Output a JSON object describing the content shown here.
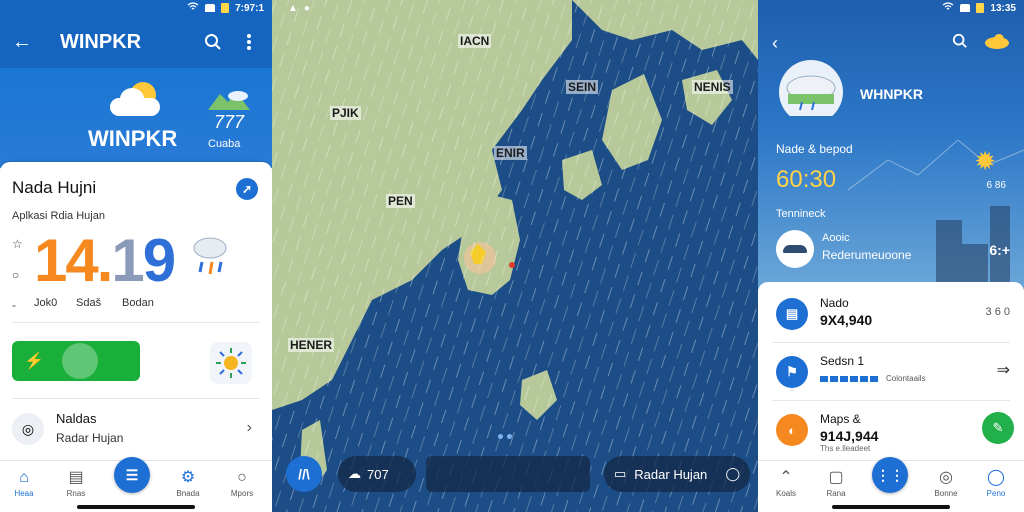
{
  "screen1": {
    "status": {
      "time": "7:97:1"
    },
    "appbar": {
      "title": "WINPKR",
      "back_icon": "arrow-left",
      "search_icon": "search",
      "more_icon": "more-vertical"
    },
    "hero": {
      "name": "WINPKR",
      "temp": "777",
      "sub": "Cuaba"
    },
    "card": {
      "heading": "Nada Hujni",
      "label": "Aplkasi Rdia Hujan",
      "big_number_part1": "14.",
      "big_number_part2": "1",
      "big_number_part3": "9",
      "mini_labels": [
        "Jok0",
        "Sdaš",
        "Bodan"
      ],
      "row": {
        "title": "Naldas",
        "subtitle": "Radar Hujan"
      }
    },
    "nav": [
      {
        "label": "Heaa",
        "icon": "home"
      },
      {
        "label": "Rnas",
        "icon": "list"
      },
      {
        "label": "",
        "icon": "menu"
      },
      {
        "label": "Bnada",
        "icon": "gear"
      },
      {
        "label": "Mpors",
        "icon": "circle"
      }
    ]
  },
  "screen2": {
    "map_labels": [
      "IACN",
      "SEIN",
      "NENIS",
      "PJIK",
      "ENIR",
      "PEN",
      "HENER"
    ],
    "bottom": {
      "temp": "707",
      "pill_label": "Radar Hujan"
    }
  },
  "screen3": {
    "status": {
      "time": "13:35"
    },
    "title": "WHNPKR",
    "subtitle": "Nade & bepod",
    "time": "60:30",
    "small_value": "6 86",
    "section_label": "Tennineck",
    "author": {
      "name": "Aooic",
      "desc": "Rederumeuoone"
    },
    "badge": "6:+",
    "rows": [
      {
        "label": "Nado",
        "value": "9X4,940",
        "extra": "3 6 0",
        "icon": "doc"
      },
      {
        "label": "Sedsn 1",
        "value": "",
        "progress_label": "Colontaails",
        "icon": "flag"
      },
      {
        "label": "Maps &",
        "value": "914J,944",
        "small": "Ths e.lleadeet",
        "icon": "map"
      }
    ],
    "nav": [
      {
        "label": "Koals",
        "icon": "up"
      },
      {
        "label": "Rana",
        "icon": "chat"
      },
      {
        "label": "",
        "icon": "grid"
      },
      {
        "label": "Bonne",
        "icon": "check"
      },
      {
        "label": "Peno",
        "icon": "user"
      }
    ]
  },
  "colors": {
    "primary": "#1565c0",
    "accent_orange": "#f5891f",
    "green": "#1aae3b",
    "sea": "#1c4d86",
    "land": "#b7c99a"
  }
}
